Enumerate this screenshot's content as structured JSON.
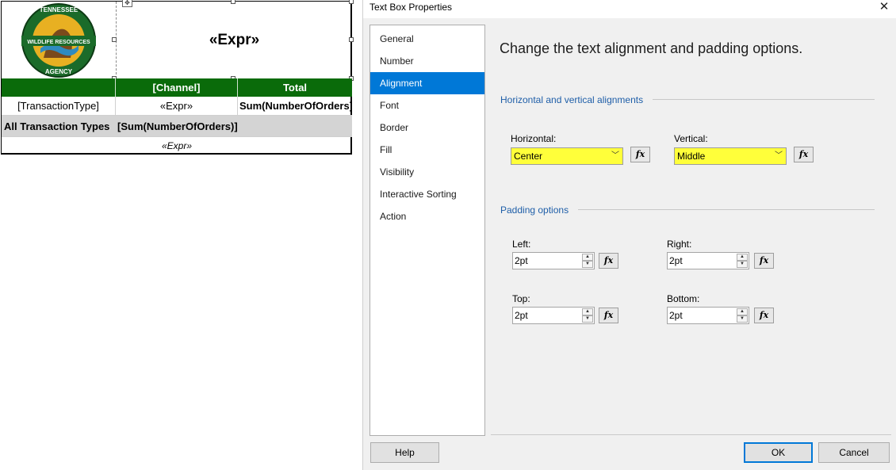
{
  "report": {
    "logo": {
      "top_text": "TENNESSEE",
      "band_text": "WILDLIFE RESOURCES",
      "bottom_text": "AGENCY",
      "colors": {
        "green": "#1b6b2a",
        "gold": "#e8b022",
        "brown": "#7a4a1c"
      }
    },
    "title_expr": "«Expr»",
    "header": {
      "blank": "",
      "channel": "[Channel]",
      "total": "Total"
    },
    "detail_row": {
      "type": "[TransactionType]",
      "expr": "«Expr»",
      "sum": "Sum(NumberOfOrders]"
    },
    "total_row": {
      "label": "All Transaction Types",
      "sum": "[Sum(NumberOfOrders)]"
    },
    "footer_expr": "«Expr»",
    "colors": {
      "header_bg": "#0a6b0a",
      "total_bg": "#d4d4d4"
    }
  },
  "dialog": {
    "title": "Text Box Properties",
    "nav": [
      {
        "label": "General"
      },
      {
        "label": "Number"
      },
      {
        "label": "Alignment",
        "active": true
      },
      {
        "label": "Font"
      },
      {
        "label": "Border"
      },
      {
        "label": "Fill"
      },
      {
        "label": "Visibility"
      },
      {
        "label": "Interactive Sorting"
      },
      {
        "label": "Action"
      }
    ],
    "heading": "Change the text alignment and padding options.",
    "alignment_group": "Horizontal and vertical alignments",
    "horizontal": {
      "label": "Horizontal:",
      "value": "Center"
    },
    "vertical": {
      "label": "Vertical:",
      "value": "Middle"
    },
    "padding_group": "Padding options",
    "padding": {
      "left": {
        "label": "Left:",
        "value": "2pt"
      },
      "right": {
        "label": "Right:",
        "value": "2pt"
      },
      "top": {
        "label": "Top:",
        "value": "2pt"
      },
      "bottom": {
        "label": "Bottom:",
        "value": "2pt"
      }
    },
    "fx_label": "fx",
    "buttons": {
      "help": "Help",
      "ok": "OK",
      "cancel": "Cancel"
    },
    "colors": {
      "highlight": "#ffff3a",
      "nav_active": "#0078d7",
      "group_title": "#1e5ea8"
    }
  }
}
